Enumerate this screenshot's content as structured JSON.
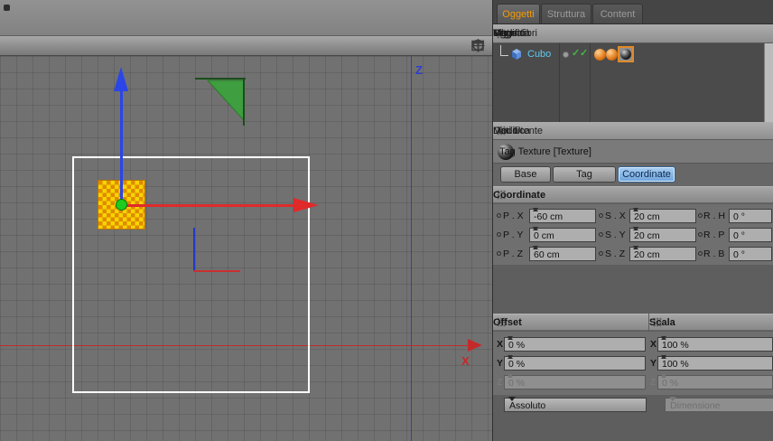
{
  "viewport": {
    "axis_z_label": "Z",
    "axis_x_label": "X"
  },
  "icons": {
    "check": "✓"
  },
  "panels": {
    "top_tabs": [
      {
        "label": "Oggetti"
      },
      {
        "label": "Struttura"
      },
      {
        "label": "Content"
      }
    ],
    "object_menu": {
      "items": [
        "File",
        "Modifica",
        "Vista",
        "Oggetti",
        "Tag",
        "Segnalibri"
      ]
    },
    "object_tree": {
      "item": "Cubo"
    },
    "attribute_menu": {
      "items": [
        "Modo",
        "Modifica",
        "Dati Utente"
      ]
    },
    "attribute_title": "Tag Texture [Texture]",
    "attribute_tabs": [
      {
        "label": "Base"
      },
      {
        "label": "Tag"
      },
      {
        "label": "Coordinate"
      }
    ],
    "coordinates": {
      "header": "Coordinate",
      "rows": [
        {
          "p_label": "P . X",
          "p_value": "-60 cm",
          "s_label": "S . X",
          "s_value": "20 cm",
          "r_label": "R . H",
          "r_value": "0 °"
        },
        {
          "p_label": "P . Y",
          "p_value": "0 cm",
          "s_label": "S . Y",
          "s_value": "20 cm",
          "r_label": "R . P",
          "r_value": "0 °"
        },
        {
          "p_label": "P . Z",
          "p_value": "60 cm",
          "s_label": "S . Z",
          "s_value": "20 cm",
          "r_label": "R . B",
          "r_value": "0 °"
        }
      ]
    },
    "mapping": {
      "offset_header": "Offset",
      "scale_header": "Scala",
      "rows": [
        {
          "label": "X",
          "offset": "0 %",
          "scale": "100 %"
        },
        {
          "label": "Y",
          "offset": "0 %",
          "scale": "100 %"
        },
        {
          "label": "Z",
          "offset": "0 %",
          "scale": "0 %"
        }
      ],
      "mode_select": "Assoluto",
      "size_select": "Dimensione"
    }
  },
  "colors": {
    "accent_orange": "#f59b00",
    "tab_selected_blue": "#6fa4da",
    "axis_x_red": "#c42a2a",
    "axis_y_blue": "#2a46e8",
    "axis_z_blue": "#2c3ed0",
    "gizmo_dot_green": "#1ecb1e",
    "texture_yellow": "#f6d400",
    "texture_orange": "#e08a00"
  }
}
